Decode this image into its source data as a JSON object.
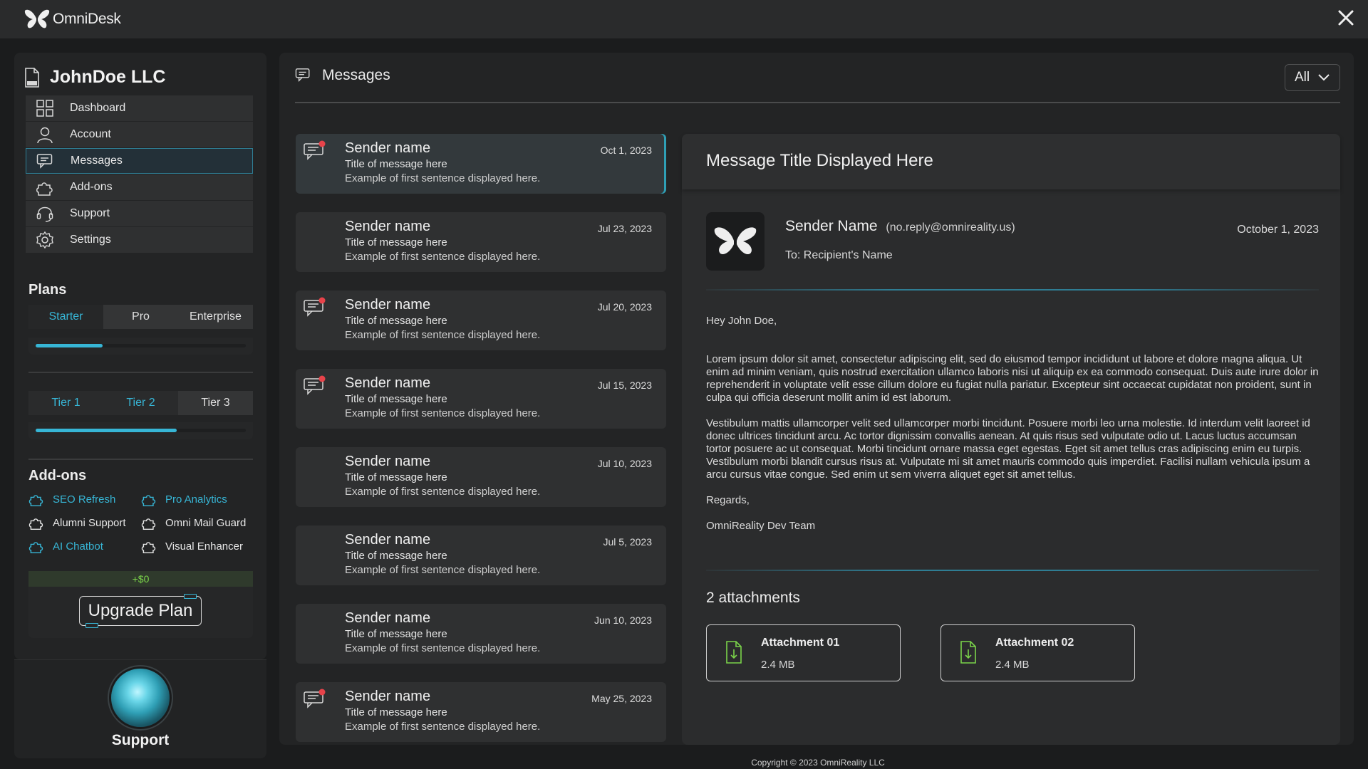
{
  "app": {
    "name": "OmniDesk",
    "close_icon": "close-icon"
  },
  "sidebar": {
    "company": "JohnDoe LLC",
    "nav": [
      {
        "label": "Dashboard",
        "icon": "dashboard-icon"
      },
      {
        "label": "Account",
        "icon": "user-icon"
      },
      {
        "label": "Messages",
        "icon": "chat-icon",
        "active": true
      },
      {
        "label": "Add-ons",
        "icon": "puzzle-icon"
      },
      {
        "label": "Support",
        "icon": "headset-icon"
      },
      {
        "label": "Settings",
        "icon": "gear-icon"
      }
    ],
    "plans": {
      "title": "Plans",
      "options": [
        "Starter",
        "Pro",
        "Enterprise"
      ],
      "selected": "Starter",
      "progress": 0.32,
      "tiers": [
        "Tier 1",
        "Tier 2",
        "Tier 3"
      ],
      "tier_progress": 0.67
    },
    "addons": {
      "title": "Add-ons",
      "items": [
        {
          "label": "SEO Refresh",
          "enabled": true
        },
        {
          "label": "Pro Analytics",
          "enabled": true
        },
        {
          "label": "Alumni Support",
          "enabled": false
        },
        {
          "label": "Omni Mail Guard",
          "enabled": false
        },
        {
          "label": "AI Chatbot",
          "enabled": true
        },
        {
          "label": "Visual Enhancer",
          "enabled": false
        }
      ],
      "price": "+$0",
      "upgrade_label": "Upgrade Plan"
    },
    "support_label": "Support"
  },
  "main": {
    "title": "Messages",
    "filter": "All",
    "messages": [
      {
        "sender": "Sender name",
        "date": "Oct 1, 2023",
        "title": "Title of message here",
        "snippet": "Example of first sentence displayed here.",
        "unread": true,
        "selected": true
      },
      {
        "sender": "Sender name",
        "date": "Jul 23, 2023",
        "title": "Title of message here",
        "snippet": "Example of first sentence displayed here.",
        "unread": false
      },
      {
        "sender": "Sender name",
        "date": "Jul 20, 2023",
        "title": "Title of message here",
        "snippet": "Example of first sentence displayed here.",
        "unread": true
      },
      {
        "sender": "Sender name",
        "date": "Jul 15, 2023",
        "title": "Title of message here",
        "snippet": "Example of first sentence displayed here.",
        "unread": true
      },
      {
        "sender": "Sender name",
        "date": "Jul 10, 2023",
        "title": "Title of message here",
        "snippet": "Example of first sentence displayed here.",
        "unread": false
      },
      {
        "sender": "Sender name",
        "date": "Jul 5, 2023",
        "title": "Title of message here",
        "snippet": "Example of first sentence displayed here.",
        "unread": false
      },
      {
        "sender": "Sender name",
        "date": "Jun 10, 2023",
        "title": "Title of message here",
        "snippet": "Example of first sentence displayed here.",
        "unread": false
      },
      {
        "sender": "Sender name",
        "date": "May 25, 2023",
        "title": "Title of message here",
        "snippet": "Example of first sentence displayed here.",
        "unread": true
      }
    ],
    "detail": {
      "title": "Message Title Displayed Here",
      "sender_name": "Sender Name",
      "sender_email": "(no.reply@omnireality.us)",
      "to": "To: Recipient's Name",
      "date": "October 1, 2023",
      "greeting": "Hey John Doe,",
      "para1": "Lorem ipsum dolor sit amet, consectetur adipiscing elit, sed do eiusmod tempor incididunt ut labore et dolore magna aliqua. Ut enim ad minim veniam, quis nostrud exercitation ullamco laboris nisi ut aliquip ex ea commodo consequat. Duis aute irure dolor in reprehenderit in voluptate velit esse cillum dolore eu fugiat nulla pariatur. Excepteur sint occaecat cupidatat non proident, sunt in culpa qui officia deserunt mollit anim id est laborum.",
      "para2": "Vestibulum mattis ullamcorper velit sed ullamcorper morbi tincidunt. Posuere morbi leo urna molestie. Id interdum velit laoreet id donec ultrices tincidunt arcu. Ac tortor dignissim convallis aenean. At quis risus sed vulputate odio ut. Lacus luctus accumsan tortor posuere ac ut consequat. Morbi tincidunt ornare massa eget egestas. Eget sit amet tellus cras adipiscing enim eu turpis. Vestibulum morbi blandit cursus risus at. Vulputate mi sit amet mauris commodo quis imperdiet. Facilisi nullam vehicula ipsum a arcu cursus vitae congue. Sed enim ut sem viverra aliquet eget sit amet tellus.",
      "closing": "Regards,",
      "signature": "OmniReality Dev Team",
      "attachments_title": "2 attachments",
      "attachments": [
        {
          "name": "Attachment 01",
          "size": "2.4 MB"
        },
        {
          "name": "Attachment 02",
          "size": "2.4 MB"
        }
      ]
    }
  },
  "footer": "Copyright © 2023 OmniReality LLC",
  "colors": {
    "accent": "#37b6d6",
    "unread_dot": "#e8434a",
    "price": "#7bd44a",
    "attachment_icon": "#7bd44a"
  }
}
